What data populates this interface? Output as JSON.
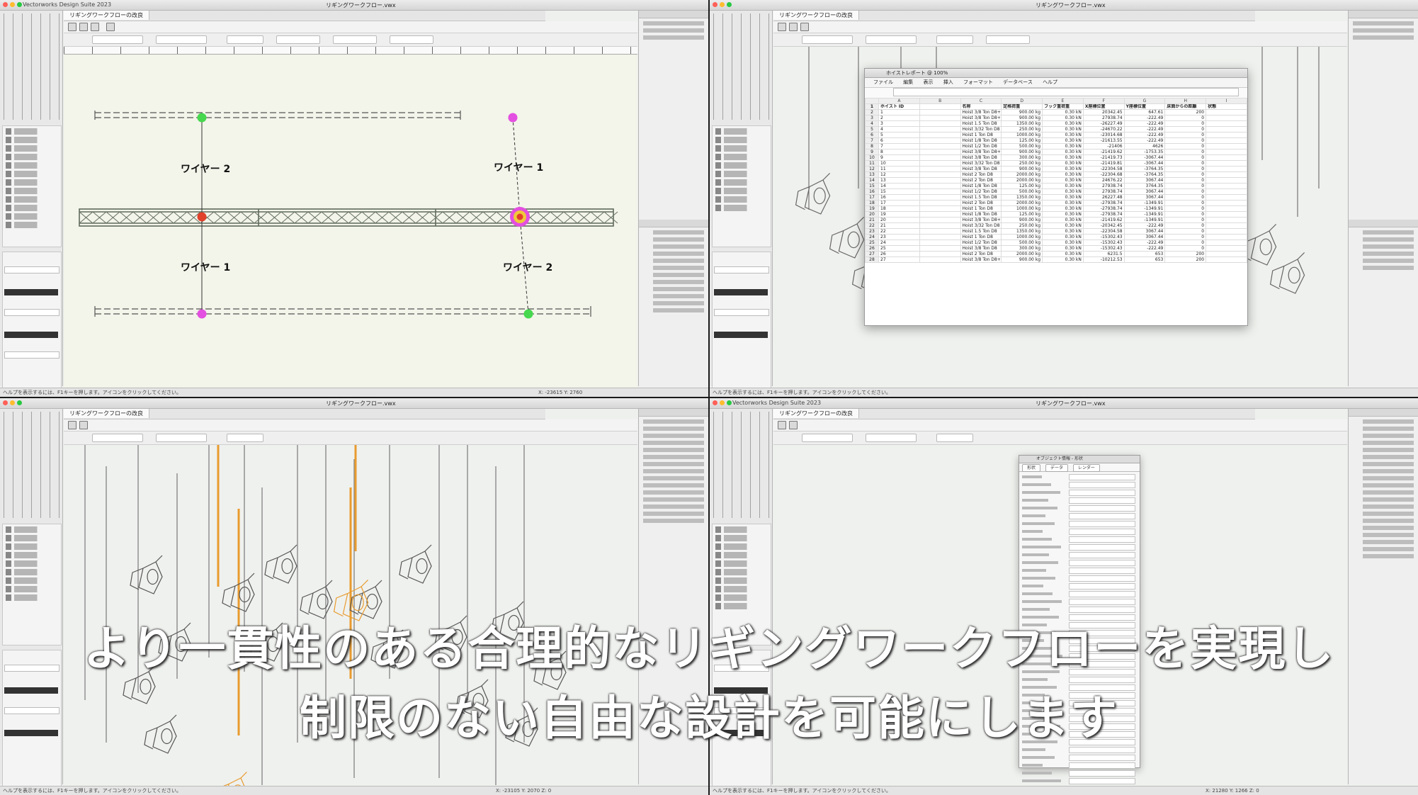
{
  "app": {
    "name": "Vectorworks Design Suite 2023",
    "document": "リギングワークフロー.vwx",
    "doc_tab": "リギングワークフローの改良",
    "status_hint": "ヘルプを表示するには、F1キーを押します。アイコンをクリックしてください。"
  },
  "colors": {
    "truss": "#5f6a5c",
    "pin_green": "#47d84f",
    "pin_magenta": "#e34fe0",
    "pin_red": "#e1402a",
    "orange_rig": "#e89b2f"
  },
  "panes": {
    "top_left": {
      "wire_labels": [
        "ワイヤー 2",
        "ワイヤー 1",
        "ワイヤー 1",
        "ワイヤー 2"
      ],
      "coords": "X: -23615   Y: 2760"
    },
    "top_right": {
      "report_title": "ホイストレポート @ 100%",
      "menu": [
        "ファイル",
        "編集",
        "表示",
        "挿入",
        "フォーマット",
        "データベース",
        "ヘルプ"
      ],
      "col_letters": [
        "A",
        "B",
        "C",
        "D",
        "E",
        "F",
        "G",
        "H",
        "I"
      ],
      "headers": [
        "ホイスト ID",
        "名称",
        "定格荷重",
        "フック重荷重",
        "X座標位置",
        "Y座標位置",
        "床面からの距離",
        "状態"
      ],
      "rows": [
        [
          "1",
          "",
          "Hoist 3/8 Ton D8+",
          "900.00 kg",
          "0.30 kN",
          "20342.45",
          "647.61",
          "200"
        ],
        [
          "2",
          "",
          "Hoist 3/8 Ton D8+",
          "900.00 kg",
          "0.30 kN",
          "27938.74",
          "-222.49",
          "0"
        ],
        [
          "3",
          "",
          "Hoist 1.5 Ton D8",
          "1350.00 kg",
          "0.30 kN",
          "-26227.49",
          "-222.49",
          "0"
        ],
        [
          "4",
          "",
          "Hoist 3/32 Ton D8",
          "250.00 kg",
          "0.30 kN",
          "-24670.22",
          "-222.49",
          "0"
        ],
        [
          "5",
          "",
          "Hoist 1 Ton D8",
          "1000.00 kg",
          "0.30 kN",
          "-23014.68",
          "-222.49",
          "0"
        ],
        [
          "6",
          "",
          "Hoist 1/8 Ton D8",
          "125.00 kg",
          "0.30 kN",
          "-21613.55",
          "-222.49",
          "0"
        ],
        [
          "7",
          "",
          "Hoist 1/2 Ton D8",
          "500.00 kg",
          "0.30 kN",
          "-21406",
          "4626",
          "0"
        ],
        [
          "8",
          "",
          "Hoist 3/8 Ton D8+",
          "900.00 kg",
          "0.30 kN",
          "-21419.62",
          "-1753.35",
          "0"
        ],
        [
          "9",
          "",
          "Hoist 3/8 Ton D8",
          "300.00 kg",
          "0.30 kN",
          "-21419.73",
          "-3067.44",
          "0"
        ],
        [
          "10",
          "",
          "Hoist 3/32 Ton D8",
          "250.00 kg",
          "0.30 kN",
          "-21419.81",
          "-3067.44",
          "0"
        ],
        [
          "11",
          "",
          "Hoist 3/8 Ton D8",
          "900.00 kg",
          "0.30 kN",
          "-22304.58",
          "-3764.35",
          "0"
        ],
        [
          "12",
          "",
          "Hoist 2 Ton D8",
          "2000.00 kg",
          "0.30 kN",
          "-22304.68",
          "-3764.35",
          "0"
        ],
        [
          "13",
          "",
          "Hoist 2 Ton D8",
          "2000.00 kg",
          "0.30 kN",
          "24676.22",
          "3067.44",
          "0"
        ],
        [
          "14",
          "",
          "Hoist 1/8 Ton D8",
          "125.00 kg",
          "0.30 kN",
          "27938.74",
          "3764.35",
          "0"
        ],
        [
          "15",
          "",
          "Hoist 1/2 Ton D8",
          "500.00 kg",
          "0.30 kN",
          "27938.74",
          "3067.44",
          "0"
        ],
        [
          "16",
          "",
          "Hoist 1.5 Ton D8",
          "1350.00 kg",
          "0.30 kN",
          "26227.48",
          "3067.44",
          "0"
        ],
        [
          "17",
          "",
          "Hoist 2 Ton D8",
          "2000.00 kg",
          "0.30 kN",
          "-27938.74",
          "-1349.91",
          "0"
        ],
        [
          "18",
          "",
          "Hoist 1 Ton D8",
          "1000.00 kg",
          "0.30 kN",
          "-27938.74",
          "-1349.91",
          "0"
        ],
        [
          "19",
          "",
          "Hoist 1/8 Ton D8",
          "125.00 kg",
          "0.30 kN",
          "-27938.74",
          "-1349.91",
          "0"
        ],
        [
          "20",
          "",
          "Hoist 3/8 Ton D8+",
          "900.00 kg",
          "0.30 kN",
          "-21419.62",
          "-1349.91",
          "0"
        ],
        [
          "21",
          "",
          "Hoist 3/32 Ton D8",
          "250.00 kg",
          "0.30 kN",
          "-20342.45",
          "-222.49",
          "0"
        ],
        [
          "22",
          "",
          "Hoist 1.5 Ton D8",
          "1350.00 kg",
          "0.30 kN",
          "-22304.58",
          "3067.44",
          "0"
        ],
        [
          "23",
          "",
          "Hoist 1 Ton D8",
          "1000.00 kg",
          "0.30 kN",
          "-15302.43",
          "3067.44",
          "0"
        ],
        [
          "24",
          "",
          "Hoist 1/2 Ton D8",
          "500.00 kg",
          "0.30 kN",
          "-15302.43",
          "-222.49",
          "0"
        ],
        [
          "25",
          "",
          "Hoist 3/8 Ton D8",
          "300.00 kg",
          "0.30 kN",
          "-15302.43",
          "-222.49",
          "0"
        ],
        [
          "26",
          "",
          "Hoist 2 Ton D8",
          "2000.00 kg",
          "0.30 kN",
          "6231.5",
          "653",
          "200"
        ],
        [
          "27",
          "",
          "Hoist 3/8 Ton D8+",
          "900.00 kg",
          "0.30 kN",
          "-10212.53",
          "653",
          "200"
        ]
      ]
    },
    "bottom_left": {
      "coords": "X: -23105   Y: 2070   Z: 0"
    },
    "bottom_right": {
      "oip_title": "オブジェクト情報 - 形状",
      "oip_tabs": [
        "形状",
        "データ",
        "レンダー"
      ],
      "coords": "X: 21280   Y: 1266   Z: 0"
    }
  },
  "caption": {
    "line1": "より一貫性のある合理的なリギングワークフローを実現し",
    "line2": "制限のない自由な設計を可能にします"
  }
}
